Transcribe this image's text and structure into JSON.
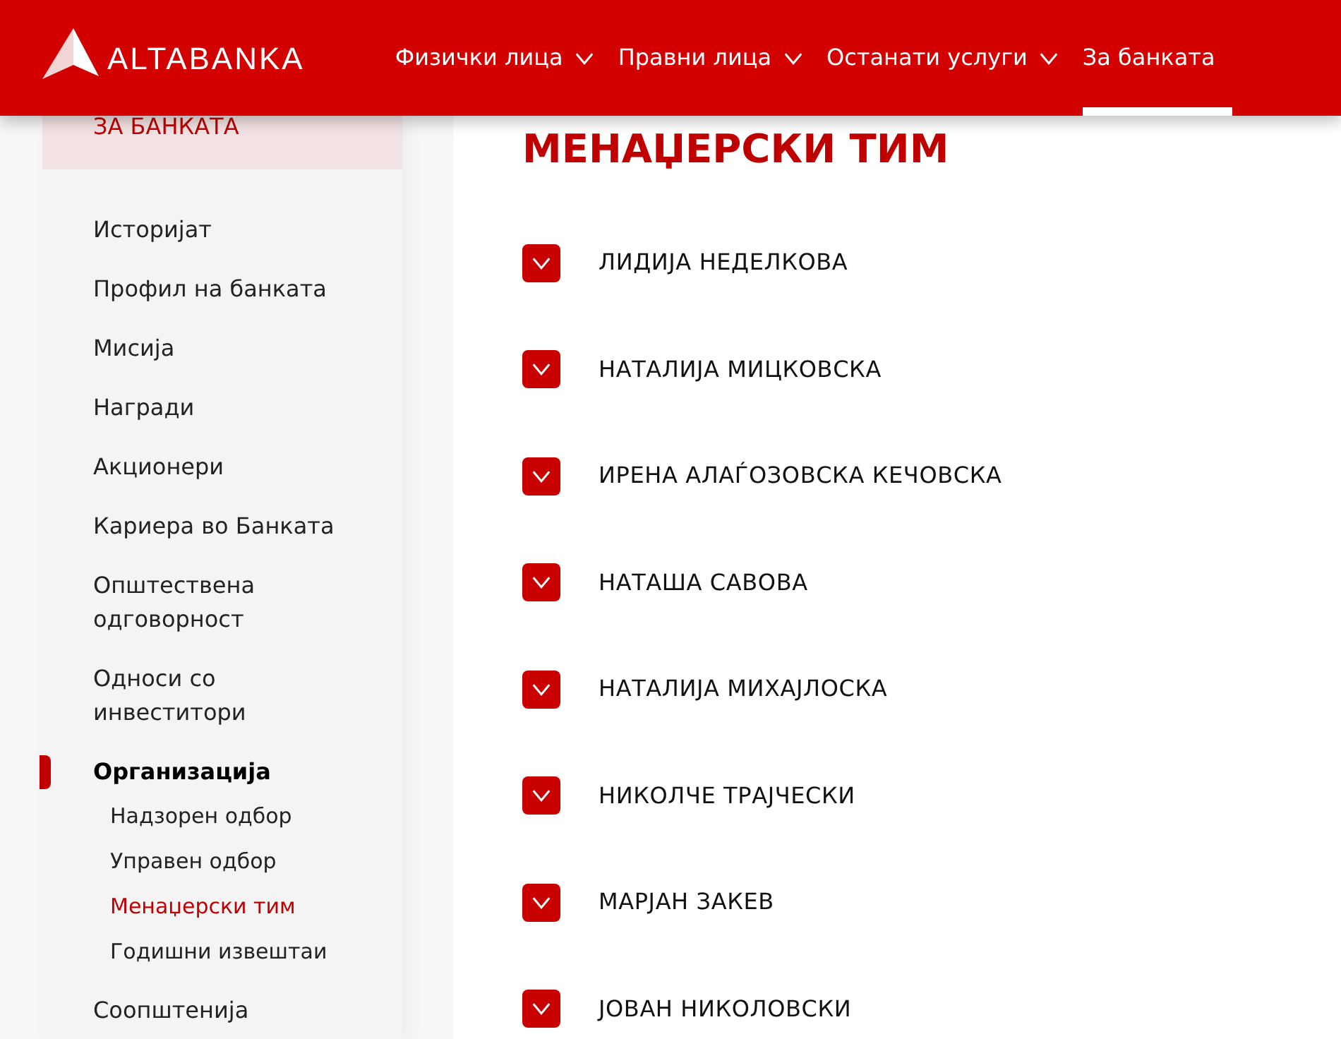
{
  "logo": {
    "text": "ALTABANKA"
  },
  "nav": [
    {
      "label": "Физички лица",
      "dropdown": true,
      "selected": false
    },
    {
      "label": "Правни лица",
      "dropdown": true,
      "selected": false
    },
    {
      "label": "Останати услуги",
      "dropdown": true,
      "selected": false
    },
    {
      "label": "За банката",
      "dropdown": false,
      "selected": true
    }
  ],
  "sidebar": {
    "heading": "ЗА БАНКАТА",
    "items": [
      {
        "label": "Историјат",
        "selected": false
      },
      {
        "label": "Профил на банката",
        "selected": false
      },
      {
        "label": "Мисија",
        "selected": false
      },
      {
        "label": "Награди",
        "selected": false
      },
      {
        "label": "Акционери",
        "selected": false
      },
      {
        "label": "Кариера во Банката",
        "selected": false
      },
      {
        "label": "Општествена одговорност",
        "selected": false
      },
      {
        "label": "Односи со инвеститори",
        "selected": false
      },
      {
        "label": "Организација",
        "selected": true,
        "children": [
          {
            "label": "Надзорен одбор",
            "selected": false
          },
          {
            "label": "Управен одбор",
            "selected": false
          },
          {
            "label": "Менаџерски тим",
            "selected": true
          },
          {
            "label": "Годишни извештаи",
            "selected": false
          }
        ]
      },
      {
        "label": "Соопштенија",
        "selected": false
      }
    ]
  },
  "main": {
    "title": "МЕНАЏЕРСКИ ТИМ",
    "members": [
      {
        "name": "ЛИДИЈА НЕДЕЛКОВА",
        "expanded": false
      },
      {
        "name": "НАТАЛИЈА МИЦКОВСКА",
        "expanded": false
      },
      {
        "name": "ИРЕНА АЛАЃОЗОВСКА КЕЧОВСКА",
        "expanded": false
      },
      {
        "name": "НАТАША САВОВА",
        "expanded": false
      },
      {
        "name": "НАТАЛИЈА МИХАЈЛОСКА",
        "expanded": false
      },
      {
        "name": "НИКОЛЧЕ ТРАЈЧЕСКИ",
        "expanded": false
      },
      {
        "name": "МАРЈАН ЗАКЕВ",
        "expanded": false
      },
      {
        "name": "ЈОВАН НИКОЛОВСКИ",
        "expanded": false
      }
    ]
  }
}
